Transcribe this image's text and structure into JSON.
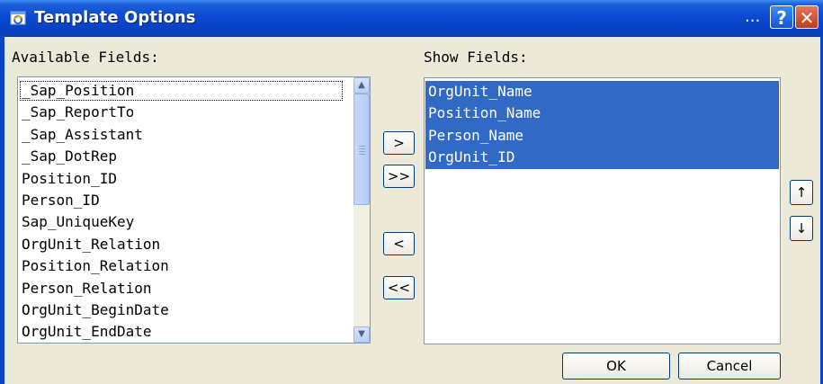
{
  "window": {
    "title": "Template Options",
    "menu_dots": "..."
  },
  "available": {
    "label": "Available Fields:",
    "items": [
      "_Sap_Position",
      "_Sap_ReportTo",
      "_Sap_Assistant",
      "_Sap_DotRep",
      "Position_ID",
      "Person_ID",
      "Sap_UniqueKey",
      "OrgUnit_Relation",
      "Position_Relation",
      "Person_Relation",
      "OrgUnit_BeginDate",
      "OrgUnit_EndDate"
    ]
  },
  "show": {
    "label": "Show Fields:",
    "items": [
      "OrgUnit_Name",
      "Position_Name",
      "Person_Name",
      "OrgUnit_ID"
    ]
  },
  "transfer": {
    "add_one": ">",
    "add_all": ">>",
    "remove_one": "<",
    "remove_all": "<<"
  },
  "order": {
    "up": "↑",
    "down": "↓"
  },
  "footer": {
    "ok_label": "OK",
    "cancel_label": "Cancel"
  },
  "icons": {
    "window_icon": "ie-window-icon",
    "help": "help-icon",
    "close": "close-icon"
  }
}
